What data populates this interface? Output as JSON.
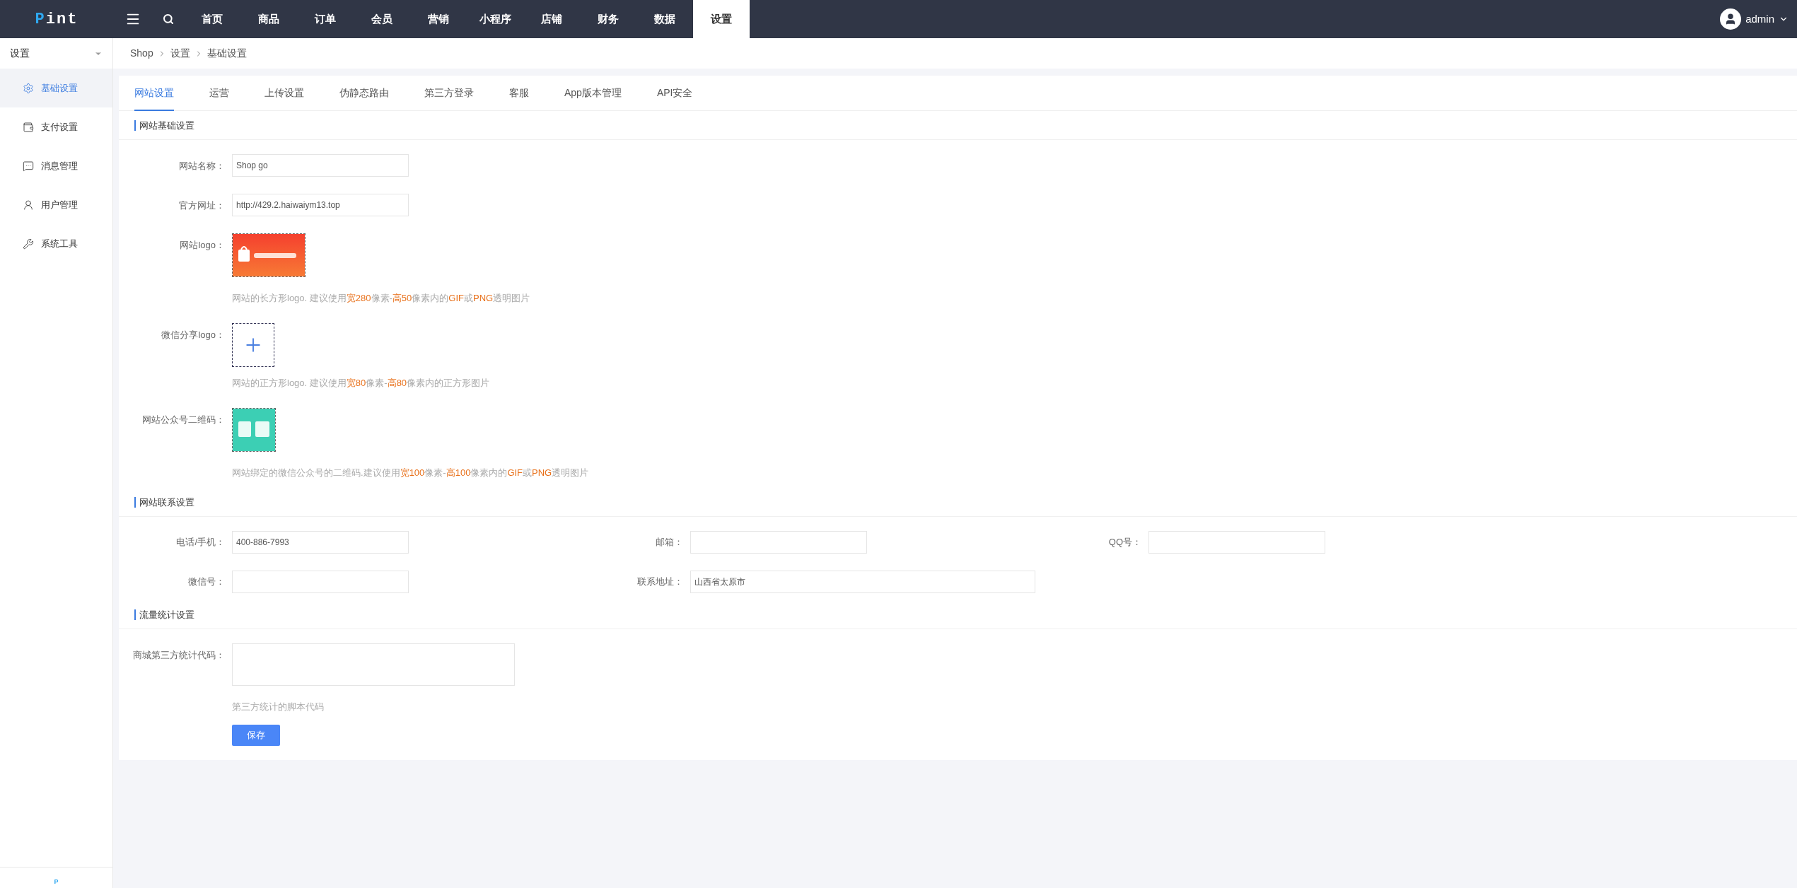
{
  "logo": {
    "first": "P",
    "rest": "int"
  },
  "nav": [
    {
      "label": "首页",
      "selected": false
    },
    {
      "label": "商品",
      "selected": false
    },
    {
      "label": "订单",
      "selected": false
    },
    {
      "label": "会员",
      "selected": false
    },
    {
      "label": "营销",
      "selected": false
    },
    {
      "label": "小程序",
      "selected": false
    },
    {
      "label": "店铺",
      "selected": false
    },
    {
      "label": "财务",
      "selected": false
    },
    {
      "label": "数据",
      "selected": false
    },
    {
      "label": "设置",
      "selected": true
    }
  ],
  "user": {
    "name": "admin"
  },
  "sidebar": {
    "title": "设置",
    "items": [
      {
        "label": "基础设置",
        "selected": true
      },
      {
        "label": "支付设置",
        "selected": false
      },
      {
        "label": "消息管理",
        "selected": false
      },
      {
        "label": "用户管理",
        "selected": false
      },
      {
        "label": "系统工具",
        "selected": false
      }
    ],
    "footer": "P"
  },
  "breadcrumb": [
    "Shop",
    "设置",
    "基础设置"
  ],
  "tabs": [
    {
      "label": "网站设置",
      "selected": true
    },
    {
      "label": "运营",
      "selected": false
    },
    {
      "label": "上传设置",
      "selected": false
    },
    {
      "label": "伪静态路由",
      "selected": false
    },
    {
      "label": "第三方登录",
      "selected": false
    },
    {
      "label": "客服",
      "selected": false
    },
    {
      "label": "App版本管理",
      "selected": false
    },
    {
      "label": "API安全",
      "selected": false
    }
  ],
  "sections": [
    {
      "title": "网站基础设置",
      "rows": [
        {
          "kind": "input",
          "label": "网站名称：",
          "value": "Shop go"
        },
        {
          "kind": "input",
          "label": "官方网址：",
          "value": "http://429.2.haiwaiym13.top"
        },
        {
          "kind": "wide_image",
          "label": "网站logo：",
          "hint": "网站的长方形logo. 建议使用**宽280**像素-**高50**像素内的**GIF**或**PNG**透明图片"
        },
        {
          "kind": "upload",
          "label": "微信分享logo：",
          "hint": "网站的正方形logo. 建议使用**宽80**像素-**高80**像素内的正方形图片"
        },
        {
          "kind": "square_image",
          "label": "网站公众号二维码：",
          "hint": "网站绑定的微信公众号的二维码.建议使用**宽100**像素-**高100**像素内的**GIF**或**PNG**透明图片"
        }
      ]
    },
    {
      "title": "网站联系设置",
      "grid": [
        [
          {
            "label": "电话/手机：",
            "value": "400-886-7993"
          },
          {
            "label": "邮箱："
          },
          {
            "label": "QQ号："
          }
        ],
        [
          {
            "label": "微信号："
          },
          {
            "label": "联系地址：",
            "value": "山西省太原市",
            "wide": true
          }
        ]
      ]
    },
    {
      "title": "流量统计设置",
      "rows": [
        {
          "kind": "textarea",
          "label": "商城第三方统计代码：",
          "hint": "第三方统计的脚本代码"
        }
      ]
    }
  ],
  "save": "保存"
}
